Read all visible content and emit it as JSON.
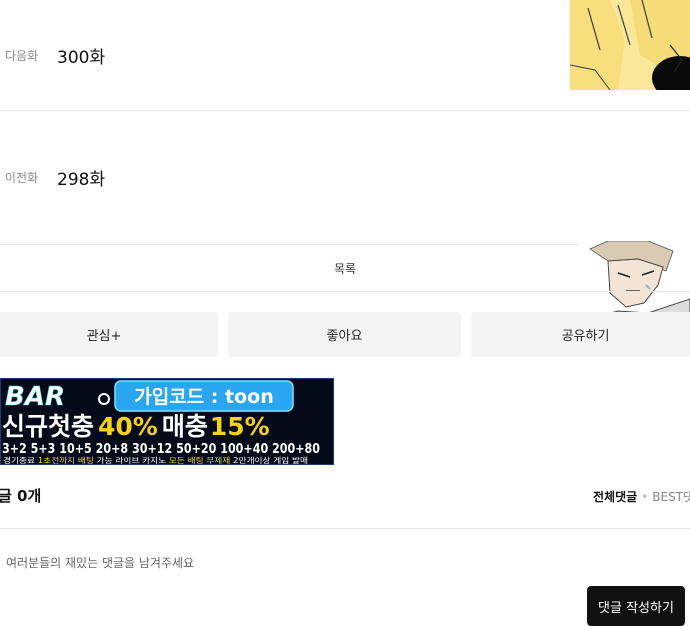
{
  "next": {
    "tag": "다음화",
    "episode": "300화"
  },
  "prev": {
    "tag": "이전화",
    "episode": "298화"
  },
  "list": {
    "label": "목록"
  },
  "actions": {
    "interest": "관심+",
    "like": "좋아요",
    "share": "공유하기"
  },
  "banner": {
    "logo": "BAR",
    "code": "가입코드 : toon",
    "headline_a": "신규첫충",
    "headline_b": "40%",
    "headline_c": "매충",
    "headline_d": "15%",
    "bonus_line": "3+2  5+3  10+5  20+8  30+12  50+20  100+40  200+80",
    "small_a": "경기종료 ",
    "small_b": "1초전까지 배팅",
    "small_c": " 가능 라이브 카지노 ",
    "small_d": "모든 배팅 무제재",
    "small_e": " 2만개이상 게임 발매"
  },
  "comments": {
    "title": "글",
    "count": "0개",
    "tab_all": "전체댓글",
    "tab_best": "BEST댓",
    "placeholder": "여러분들의 재밌는 댓글을 남겨주세요",
    "write_button": "댓글 작성하기"
  },
  "colors": {
    "accent_yellow": "#f5d21a",
    "accent_cyan": "#2ad4f0",
    "banner_bg": "#050a18",
    "button_dark": "#111111"
  }
}
